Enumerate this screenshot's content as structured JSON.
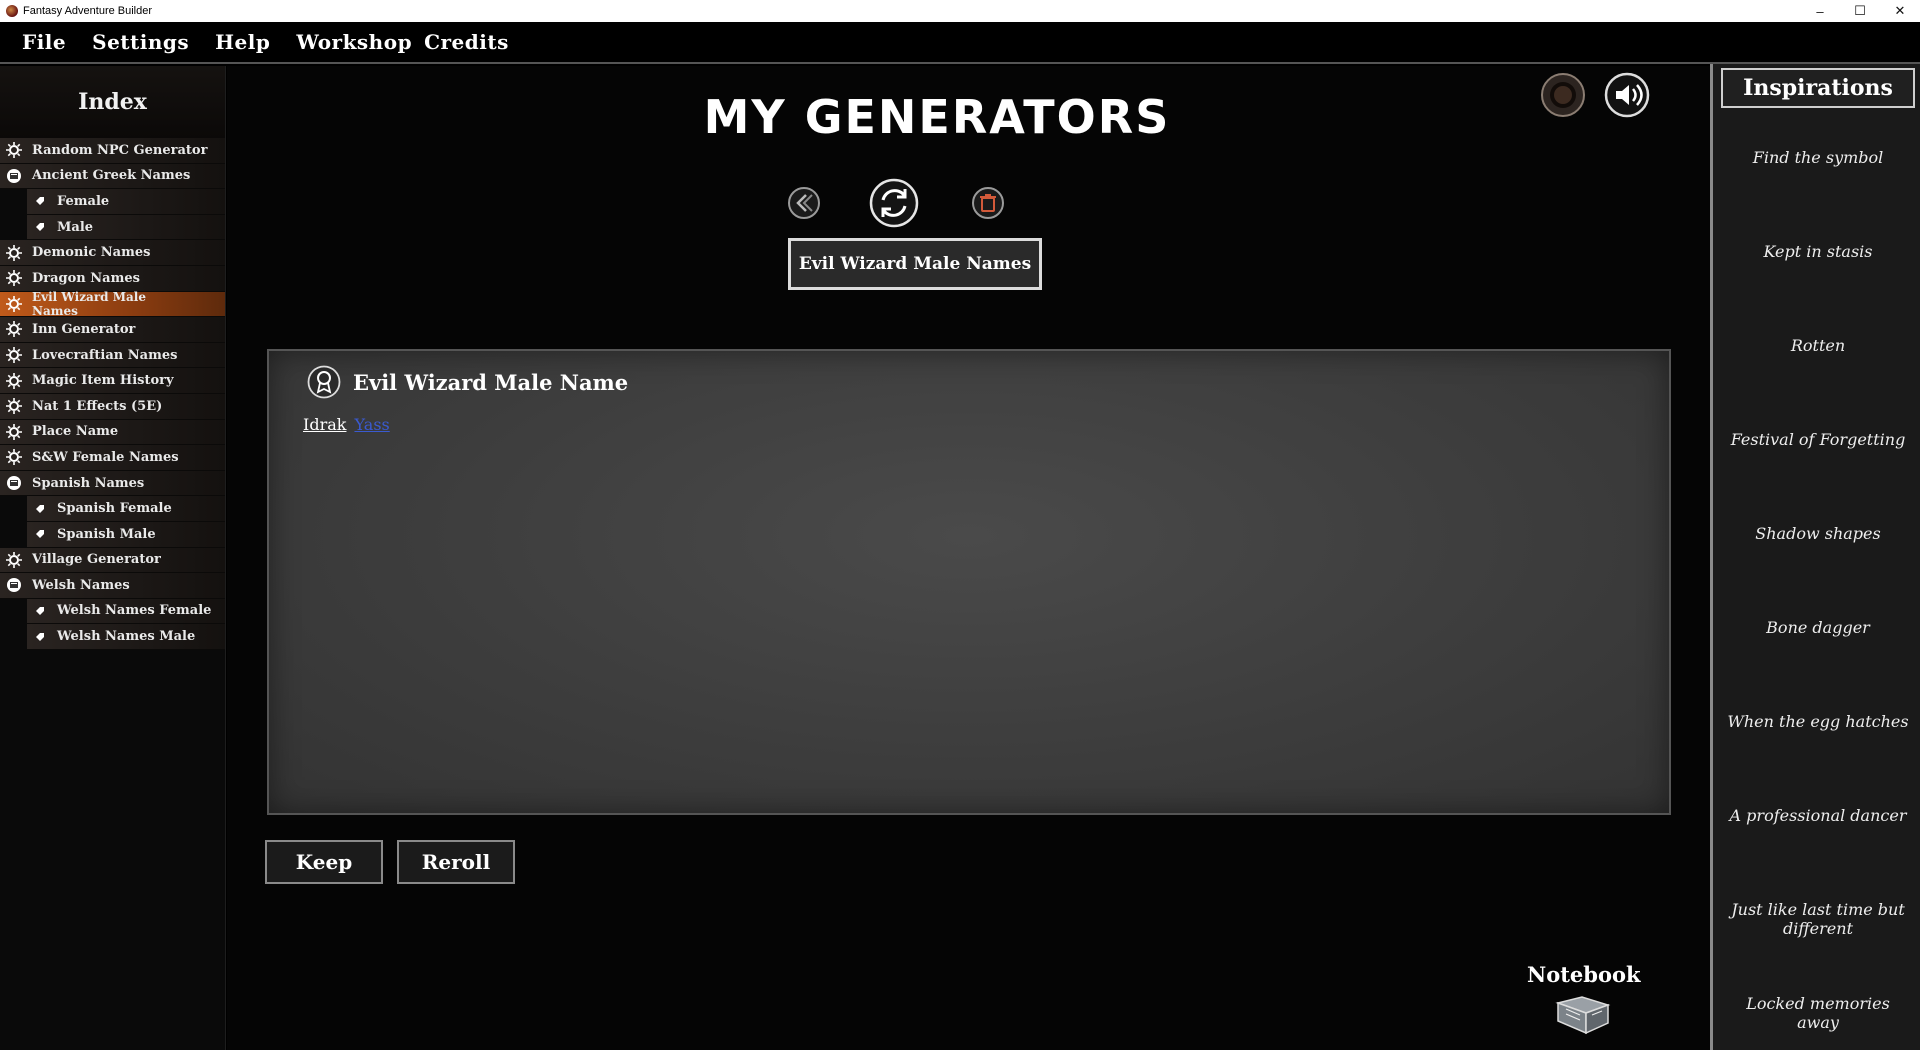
{
  "window": {
    "title": "Fantasy Adventure Builder",
    "controls": [
      "–",
      "☐",
      "✕"
    ]
  },
  "menu": [
    "File",
    "Settings",
    "Help",
    "Workshop",
    "Credits"
  ],
  "sidebar": {
    "title": "Index",
    "items": [
      {
        "label": "Random NPC Generator",
        "type": "generator"
      },
      {
        "label": "Ancient Greek Names",
        "type": "folder"
      },
      {
        "label": "Female",
        "type": "child"
      },
      {
        "label": "Male",
        "type": "child"
      },
      {
        "label": "Demonic Names",
        "type": "generator"
      },
      {
        "label": "Dragon Names",
        "type": "generator"
      },
      {
        "label": "Evil Wizard Male Names",
        "type": "generator",
        "active": true
      },
      {
        "label": "Inn Generator",
        "type": "generator"
      },
      {
        "label": "Lovecraftian Names",
        "type": "generator"
      },
      {
        "label": "Magic Item History",
        "type": "generator"
      },
      {
        "label": "Nat 1 Effects (5E)",
        "type": "generator"
      },
      {
        "label": "Place Name",
        "type": "generator"
      },
      {
        "label": "S&W Female Names",
        "type": "generator"
      },
      {
        "label": "Spanish Names",
        "type": "folder"
      },
      {
        "label": "Spanish Female",
        "type": "child"
      },
      {
        "label": "Spanish Male",
        "type": "child"
      },
      {
        "label": "Village Generator",
        "type": "generator"
      },
      {
        "label": "Welsh Names",
        "type": "folder"
      },
      {
        "label": "Welsh Names Female",
        "type": "child"
      },
      {
        "label": "Welsh Names Male",
        "type": "child"
      }
    ]
  },
  "main": {
    "title": "MY GENERATORS",
    "current_generator": "Evil Wizard Male Names",
    "result": {
      "title": "Evil Wizard Male Name",
      "value_1": "Idrak",
      "value_2": "Yass"
    },
    "keep_label": "Keep",
    "reroll_label": "Reroll",
    "notebook_label": "Notebook",
    "icons": [
      "back-icon",
      "refresh-icon",
      "delete-icon",
      "record-icon",
      "speaker-icon",
      "notebook-icon"
    ]
  },
  "inspirations": {
    "title": "Inspirations",
    "items": [
      "Find the symbol",
      "Kept in stasis",
      "Rotten",
      "Festival of Forgetting",
      "Shadow shapes",
      "Bone dagger",
      "When the egg hatches",
      "A professional dancer",
      "Just like last time but different",
      "Locked memories away"
    ]
  },
  "colors": {
    "active_item": "#c05a1a",
    "link": "#3a5ad0",
    "panel": "#444444"
  }
}
